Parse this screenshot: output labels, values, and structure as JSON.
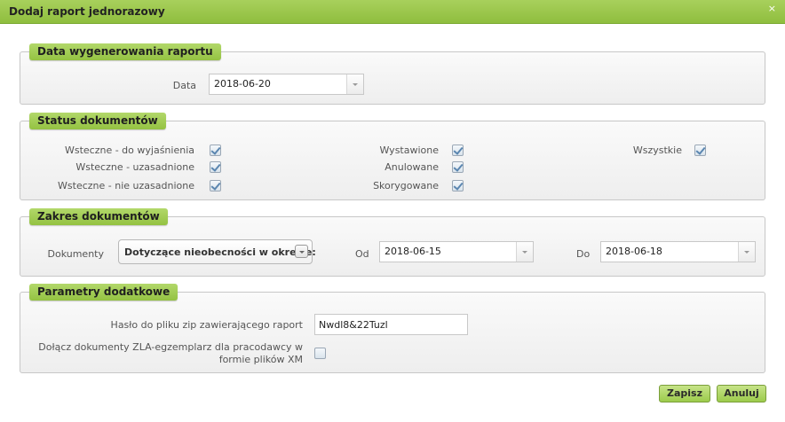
{
  "dialog": {
    "title": "Dodaj raport jednorazowy",
    "close_symbol": "×"
  },
  "section_date": {
    "legend": "Data wygenerowania raportu",
    "data_label": "Data",
    "data_value": "2018-06-20"
  },
  "section_status": {
    "legend": "Status dokumentów",
    "items": [
      {
        "label": "Wsteczne - do wyjaśnienia",
        "checked": true
      },
      {
        "label": "Wsteczne - uzasadnione",
        "checked": true
      },
      {
        "label": "Wsteczne - nie uzasadnione",
        "checked": true
      },
      {
        "label": "Wystawione",
        "checked": true
      },
      {
        "label": "Anulowane",
        "checked": true
      },
      {
        "label": "Skorygowane",
        "checked": true
      },
      {
        "label": "Wszystkie",
        "checked": true
      }
    ]
  },
  "section_range": {
    "legend": "Zakres dokumentów",
    "documents_label": "Dokumenty",
    "documents_value": "Dotyczące nieobecności w okresie:",
    "from_label": "Od",
    "from_value": "2018-06-15",
    "to_label": "Do",
    "to_value": "2018-06-18"
  },
  "section_params": {
    "legend": "Parametry dodatkowe",
    "password_label": "Hasło do pliku zip zawierającego raport",
    "password_value": "Nwdl8&22Tuzl",
    "zla_label_line1": "Dołącz dokumenty ZLA-egzemplarz dla pracodawcy w",
    "zla_label_line2": "formie plików XM",
    "zla_checked": false
  },
  "buttons": {
    "save": "Zapisz",
    "cancel": "Anuluj"
  }
}
